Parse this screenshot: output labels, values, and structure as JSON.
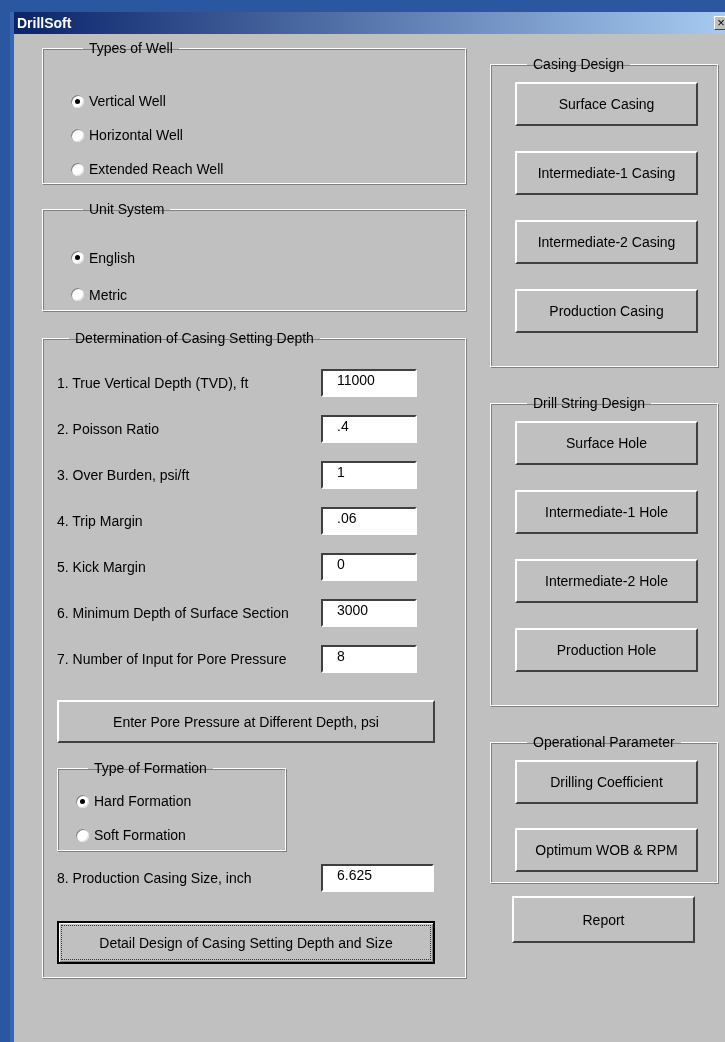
{
  "window": {
    "title": "DrillSoft",
    "close_button": "×"
  },
  "types_of_well": {
    "title": "Types of Well",
    "options": [
      {
        "label": "Vertical Well",
        "selected": true
      },
      {
        "label": "Horizontal Well",
        "selected": false
      },
      {
        "label": "Extended Reach Well",
        "selected": false
      }
    ]
  },
  "unit_system": {
    "title": "Unit System",
    "options": [
      {
        "label": "English",
        "selected": true
      },
      {
        "label": "Metric",
        "selected": false
      }
    ]
  },
  "casing_setting_depth": {
    "title": "Determination of Casing Setting Depth",
    "fields": [
      {
        "label": "1. True Vertical Depth (TVD), ft",
        "value": "11000"
      },
      {
        "label": "2. Poisson Ratio",
        "value": ".4"
      },
      {
        "label": "3. Over Burden, psi/ft",
        "value": "1"
      },
      {
        "label": "4. Trip Margin",
        "value": ".06"
      },
      {
        "label": "5. Kick Margin",
        "value": "0"
      },
      {
        "label": "6. Minimum Depth of Surface Section",
        "value": "3000"
      },
      {
        "label": "7. Number of Input for Pore Pressure",
        "value": "8"
      }
    ],
    "pore_pressure_button": {
      "label": "Enter Pore Pressure at Different Depth, psi",
      "focused": false
    },
    "type_of_formation": {
      "title": "Type of Formation",
      "options": [
        {
          "label": "Hard Formation",
          "selected": true
        },
        {
          "label": "Soft Formation",
          "selected": false
        }
      ]
    },
    "casing_size": {
      "label": "8. Production Casing Size, inch",
      "value": "6.625"
    },
    "detail_button": {
      "label": "Detail Design of Casing Setting Depth and Size",
      "focused": true
    }
  },
  "casing_design": {
    "title": "Casing Design",
    "buttons": [
      "Surface Casing",
      "Intermediate-1 Casing",
      "Intermediate-2 Casing",
      "Production Casing"
    ]
  },
  "drill_string_design": {
    "title": "Drill String Design",
    "buttons": [
      "Surface Hole",
      "Intermediate-1 Hole",
      "Intermediate-2 Hole",
      "Production Hole"
    ]
  },
  "operational_parameter": {
    "title": "Operational Parameter",
    "buttons": [
      "Drilling Coefficient",
      "Optimum WOB & RPM"
    ]
  },
  "report_button": "Report"
}
